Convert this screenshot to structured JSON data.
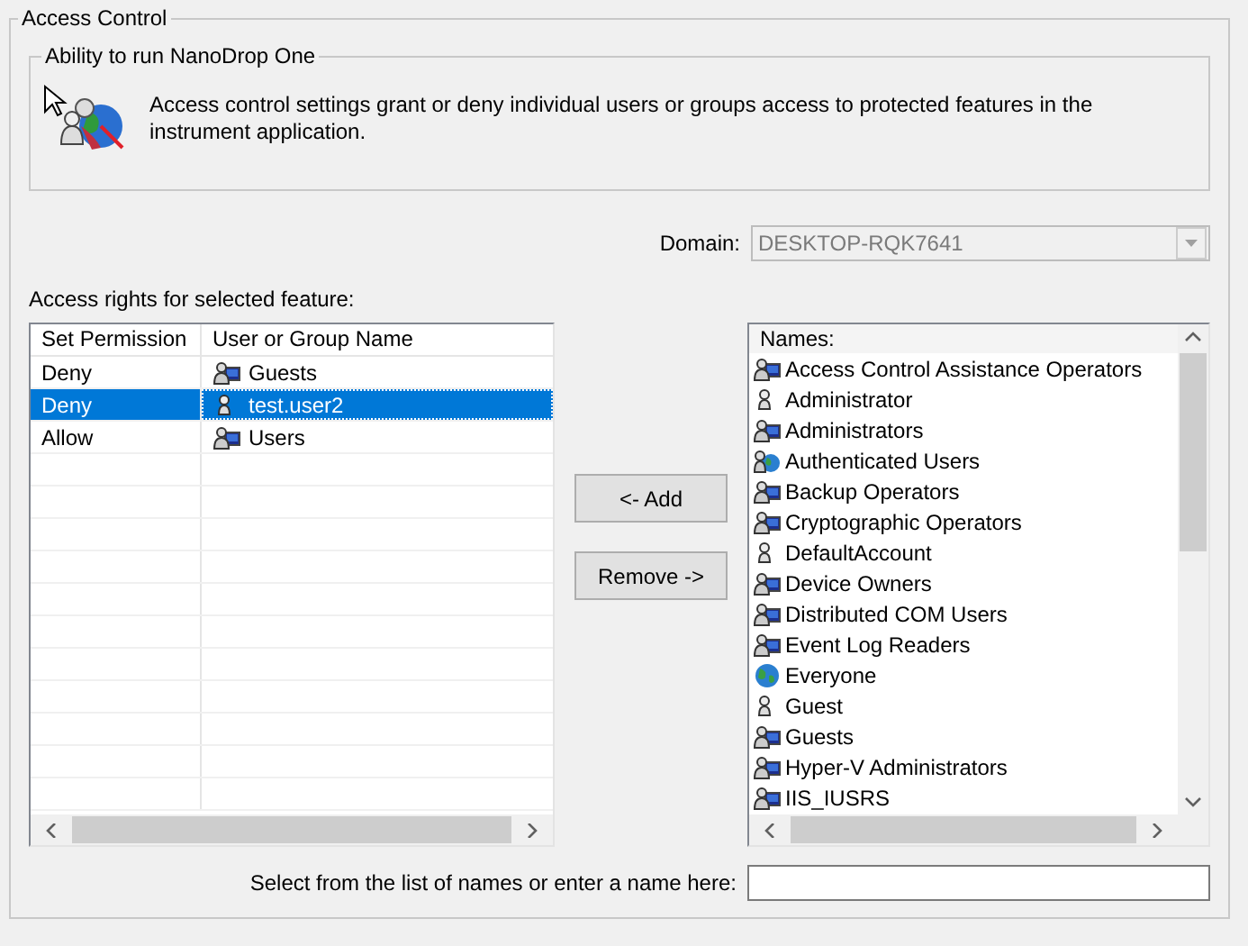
{
  "group": {
    "title": "Access Control"
  },
  "feature": {
    "title": "Ability to run NanoDrop One",
    "description": "Access control settings grant or deny individual users or groups access to protected features in the instrument application."
  },
  "domain": {
    "label": "Domain:",
    "value": "DESKTOP-RQK7641",
    "disabled": true
  },
  "rights": {
    "label": "Access rights for selected feature:",
    "columns": [
      "Set Permission",
      "User or Group Name"
    ],
    "rows": [
      {
        "permission": "Deny",
        "name": "Guests",
        "kind": "group",
        "selected": false
      },
      {
        "permission": "Deny",
        "name": "test.user2",
        "kind": "user",
        "selected": true
      },
      {
        "permission": "Allow",
        "name": "Users",
        "kind": "group",
        "selected": false
      }
    ]
  },
  "buttons": [
    {
      "label": "<- Add"
    },
    {
      "label": "Remove ->"
    }
  ],
  "names": {
    "header": "Names:",
    "items": [
      {
        "name": "Access Control Assistance Operators",
        "kind": "group"
      },
      {
        "name": "Administrator",
        "kind": "user"
      },
      {
        "name": "Administrators",
        "kind": "group"
      },
      {
        "name": "Authenticated Users",
        "kind": "network-group"
      },
      {
        "name": "Backup Operators",
        "kind": "group"
      },
      {
        "name": "Cryptographic Operators",
        "kind": "group"
      },
      {
        "name": "DefaultAccount",
        "kind": "user"
      },
      {
        "name": "Device Owners",
        "kind": "group"
      },
      {
        "name": "Distributed COM Users",
        "kind": "group"
      },
      {
        "name": "Event Log Readers",
        "kind": "group"
      },
      {
        "name": "Everyone",
        "kind": "globe"
      },
      {
        "name": "Guest",
        "kind": "user"
      },
      {
        "name": "Guests",
        "kind": "group"
      },
      {
        "name": "Hyper-V Administrators",
        "kind": "group"
      },
      {
        "name": "IIS_IUSRS",
        "kind": "group"
      }
    ]
  },
  "entry": {
    "label": "Select from the list of names or enter a name here:"
  }
}
